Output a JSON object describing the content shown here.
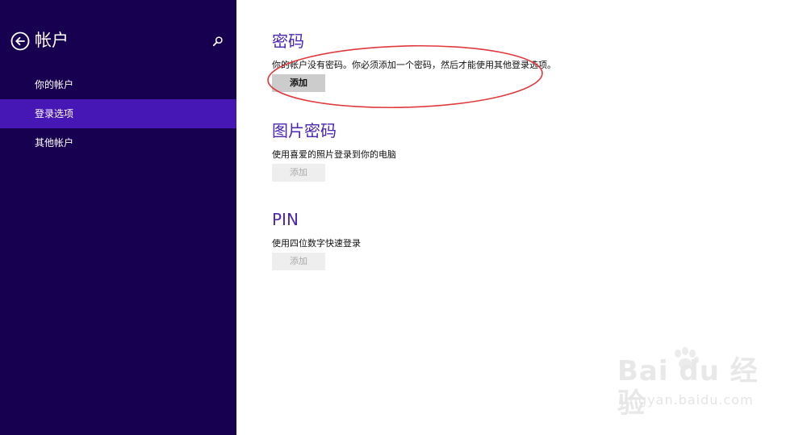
{
  "sidebar": {
    "title": "帐户",
    "back_icon": "back-arrow-circle-icon",
    "search_icon": "search-icon",
    "items": [
      {
        "label": "你的帐户",
        "active": false
      },
      {
        "label": "登录选项",
        "active": true
      },
      {
        "label": "其他帐户",
        "active": false
      }
    ]
  },
  "sections": {
    "password": {
      "title": "密码",
      "description": "你的帐户没有密码。你必须添加一个密码，然后才能使用其他登录选项。",
      "button": "添加"
    },
    "picture_password": {
      "title": "图片密码",
      "description": "使用喜爱的照片登录到你的电脑",
      "button": "添加"
    },
    "pin": {
      "title": "PIN",
      "description": "使用四位数字快速登录",
      "button": "添加"
    }
  },
  "watermark": {
    "logo_text": "Bai du 经验",
    "url": "jingyan.baidu.com"
  },
  "colors": {
    "sidebar_bg": "#180050",
    "nav_active": "#4617b4",
    "section_title": "#4a26b2",
    "annotation": "#e0393e"
  }
}
